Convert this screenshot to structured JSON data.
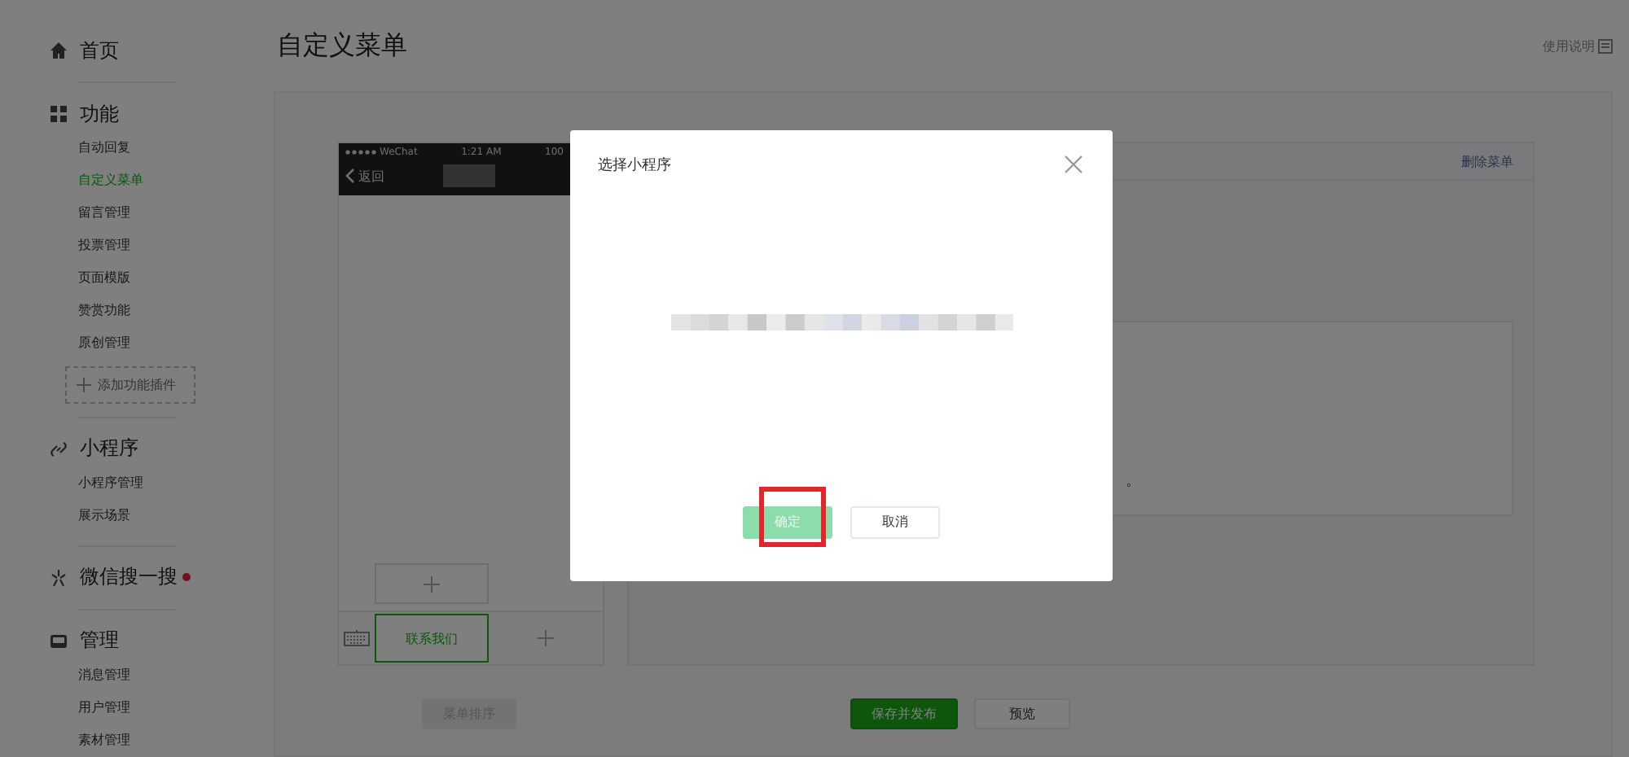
{
  "sidebar": {
    "sections": [
      {
        "label": "首页",
        "kind": "home",
        "dot": false
      },
      {
        "label": "功能",
        "kind": "grid",
        "dot": false,
        "items": [
          {
            "label": "自动回复",
            "selected": false
          },
          {
            "label": "自定义菜单",
            "selected": true
          },
          {
            "label": "留言管理",
            "selected": false
          },
          {
            "label": "投票管理",
            "selected": false
          },
          {
            "label": "页面模版",
            "selected": false
          },
          {
            "label": "赞赏功能",
            "selected": false
          },
          {
            "label": "原创管理",
            "selected": false
          }
        ],
        "add_button": "添加功能插件"
      },
      {
        "label": "小程序",
        "kind": "link",
        "dot": false,
        "items": [
          {
            "label": "小程序管理",
            "selected": false
          },
          {
            "label": "展示场景",
            "selected": false
          }
        ]
      },
      {
        "label": "微信搜一搜",
        "kind": "spark",
        "dot": true
      },
      {
        "label": "管理",
        "kind": "inbox",
        "dot": false,
        "items": [
          {
            "label": "消息管理",
            "selected": false
          },
          {
            "label": "用户管理",
            "selected": false
          },
          {
            "label": "素材管理",
            "selected": false
          }
        ]
      }
    ]
  },
  "page": {
    "title": "自定义菜单",
    "help_link": "使用说明"
  },
  "phone": {
    "carrier": "WeChat",
    "time": "1:21 AM",
    "battery": "100",
    "back": "返回",
    "menu": [
      {
        "label": "联系我们",
        "selected": true
      }
    ]
  },
  "editor": {
    "delete_link": "删除菜单",
    "fragment": "。"
  },
  "footer_buttons": [
    {
      "label": "菜单排序",
      "kind": "disabled"
    },
    {
      "label": "保存并发布",
      "kind": "primary"
    },
    {
      "label": "预览",
      "kind": "default"
    }
  ],
  "dialog": {
    "title": "选择小程序",
    "buttons": [
      {
        "label": "确定",
        "kind": "primary",
        "disabled": true,
        "highlighted": true
      },
      {
        "label": "取消",
        "kind": "default",
        "disabled": false,
        "highlighted": false
      }
    ]
  }
}
